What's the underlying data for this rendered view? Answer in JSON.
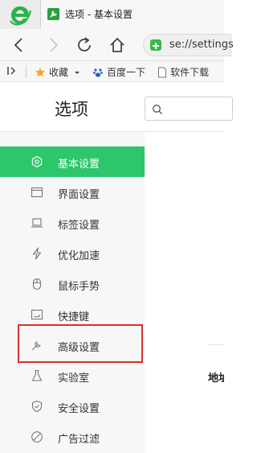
{
  "tab": {
    "title": "选项 - 基本设置"
  },
  "address": {
    "url": "se://settings"
  },
  "bookmarks": {
    "items": [
      "收藏",
      "百度一下",
      "软件下载"
    ]
  },
  "header": {
    "title": "选项",
    "search_placeholder": ""
  },
  "sidebar": {
    "items": [
      {
        "label": "基本设置",
        "icon": "gear-icon",
        "active": true
      },
      {
        "label": "界面设置",
        "icon": "window-icon",
        "active": false
      },
      {
        "label": "标签设置",
        "icon": "laptop-icon",
        "active": false
      },
      {
        "label": "优化加速",
        "icon": "lightning-icon",
        "active": false
      },
      {
        "label": "鼠标手势",
        "icon": "mouse-icon",
        "active": false
      },
      {
        "label": "快捷键",
        "icon": "keyboard-icon",
        "active": false
      },
      {
        "label": "高级设置",
        "icon": "wrench-icon",
        "active": false
      },
      {
        "label": "实验室",
        "icon": "flask-icon",
        "active": false
      },
      {
        "label": "安全设置",
        "icon": "shield-icon",
        "active": false
      },
      {
        "label": "广告过滤",
        "icon": "block-icon",
        "active": false
      }
    ]
  },
  "content": {
    "partial_label": "地址"
  },
  "colors": {
    "active": "#2dc66b",
    "highlight": "#d9302c",
    "brand_green": "#3cb84c"
  }
}
